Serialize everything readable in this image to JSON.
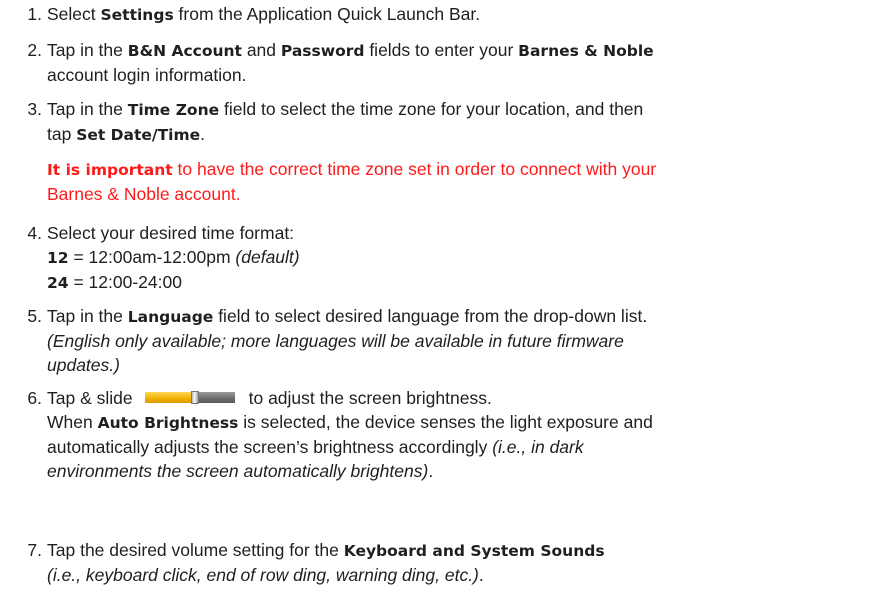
{
  "steps": [
    {
      "num": "1.",
      "a": "Select ",
      "b": "Settings",
      "c": " from the Application Quick Launch Bar."
    },
    {
      "num": "2.",
      "a": "Tap in the ",
      "b": "B&N Account",
      "c": " and ",
      "d": "Password",
      "e": " fields to enter your ",
      "f": "Barnes & Noble",
      "g": "account login information."
    },
    {
      "num": "3.",
      "a": "Tap in the ",
      "b": "Time Zone",
      "c": " field to select the time zone for your location, and then",
      "d": "tap ",
      "e": "Set Date/Time",
      "f": ".",
      "note_bold": "It is important",
      "note_1": " to have the correct time zone set in order to connect with your",
      "note_2": "Barnes & Noble account."
    },
    {
      "num": "4.",
      "a": "Select your desired time format:",
      "b12": "12",
      "c12": " = 12:00am-12:00pm ",
      "d12": "(default)",
      "b24": "24",
      "c24": " = 12:00-24:00"
    },
    {
      "num": "5.",
      "a": "Tap in the ",
      "b": "Language",
      "c": " field to select desired language from the drop-down list.",
      "d": "(English only available; more languages will be available in future firmware",
      "e": "updates.)"
    },
    {
      "num": "6.",
      "a": "Tap & slide",
      "b": "to adjust the screen brightness.",
      "c": "When ",
      "d": "Auto Brightness",
      "e": " is selected, the device senses the light exposure and",
      "f": "automatically adjusts the screen’s brightness accordingly ",
      "g": "(i.e., in dark",
      "h": "environments the screen automatically brightens)",
      "i": "."
    },
    {
      "num": "7.",
      "a": "Tap the desired volume setting for the ",
      "b": "Keyboard and System Sounds",
      "c": "(i.e., keyboard click, end of row ding, warning ding, etc.)",
      "d": "."
    }
  ],
  "slider": {
    "icon": "brightness-slider-icon",
    "level_fraction": 0.55,
    "fill_color": "#f0b000",
    "track_color": "#6a6a6a"
  },
  "colors": {
    "note": "#ff1a1a",
    "text": "#1f1f1f"
  }
}
